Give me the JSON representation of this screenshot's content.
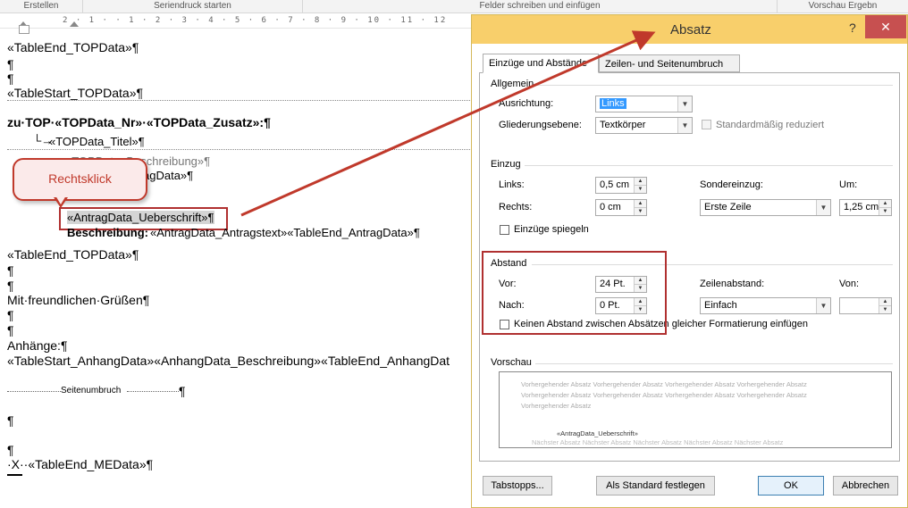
{
  "ribbon": {
    "groups": [
      "Erstellen",
      "Seriendruck starten",
      "Felder schreiben und einfügen",
      "Vorschau Ergebn"
    ]
  },
  "ruler": {
    "numbers": "2 · 1 · · 1 · 2 · 3 · 4 · 5 · 6 · 7 · 8 · 9 · 10 · 11 · 12"
  },
  "document": {
    "lines": [
      "«TableEnd_TOPData»¶",
      "¶",
      "¶",
      "«TableStart_TOPData»¶",
      "zu·TOP·«TOPData_Nr»·«TOPData_Zusatz»:¶",
      "«TOPData_Titel»¶",
      "«TOPData_Beschreibung»¶",
      "agData»¶",
      "«AntragData_Ueberschrift»¶",
      "Beschreibung:",
      "«AntragData_Antragstext»«TableEnd_AntragData»¶",
      "«TableEnd_TOPData»¶",
      "¶",
      "¶",
      "Mit·freundlichen·Grüßen¶",
      "¶",
      "¶",
      "Anhänge:¶",
      "«TableStart_AnhangData»«AnhangData_Beschreibung»«TableEnd_AnhangDat",
      "Seitenumbruch",
      "¶",
      "¶",
      "¶",
      "·X··«TableEnd_MEData»¶"
    ],
    "callout": "Rechtsklick"
  },
  "dialog": {
    "title": "Absatz",
    "help": "?",
    "close": "✕",
    "tabs": [
      "Einzüge und Abstände",
      "Zeilen- und Seitenumbruch"
    ],
    "allgemein": {
      "title": "Allgemein",
      "ausrichtung_label": "Ausrichtung:",
      "ausrichtung_value": "Links",
      "gliederung_label": "Gliederungsebene:",
      "gliederung_value": "Textkörper",
      "reduziert_label": "Standardmäßig reduziert"
    },
    "einzug": {
      "title": "Einzug",
      "links_label": "Links:",
      "links_value": "0,5 cm",
      "rechts_label": "Rechts:",
      "rechts_value": "0 cm",
      "sonder_label": "Sondereinzug:",
      "sonder_value": "Erste Zeile",
      "um_label": "Um:",
      "um_value": "1,25 cm",
      "spiegeln_label": "Einzüge spiegeln"
    },
    "abstand": {
      "title": "Abstand",
      "vor_label": "Vor:",
      "vor_value": "24 Pt.",
      "nach_label": "Nach:",
      "nach_value": "0 Pt.",
      "zeilen_label": "Zeilenabstand:",
      "zeilen_value": "Einfach",
      "von_label": "Von:",
      "von_value": "",
      "kein_abstand_label": "Keinen Abstand zwischen Absätzen gleicher Formatierung einfügen"
    },
    "vorschau": {
      "title": "Vorschau",
      "prev_lines": [
        "Vorhergehender Absatz Vorhergehender Absatz Vorhergehender Absatz Vorhergehender Absatz",
        "Vorhergehender Absatz Vorhergehender Absatz Vorhergehender Absatz Vorhergehender Absatz",
        "Vorhergehender Absatz"
      ],
      "current": "«AntragData_Ueberschrift»",
      "next": "Nächster Absatz Nächster Absatz Nächster Absatz Nächster Absatz Nächster Absatz"
    },
    "buttons": {
      "tabstopps": "Tabstopps...",
      "standard": "Als Standard festlegen",
      "ok": "OK",
      "abbrechen": "Abbrechen"
    }
  },
  "colors": {
    "titlebar": "#f8cf6b",
    "close": "#c75050",
    "annotation_red": "#c0392b",
    "selection": "#3399ff"
  }
}
